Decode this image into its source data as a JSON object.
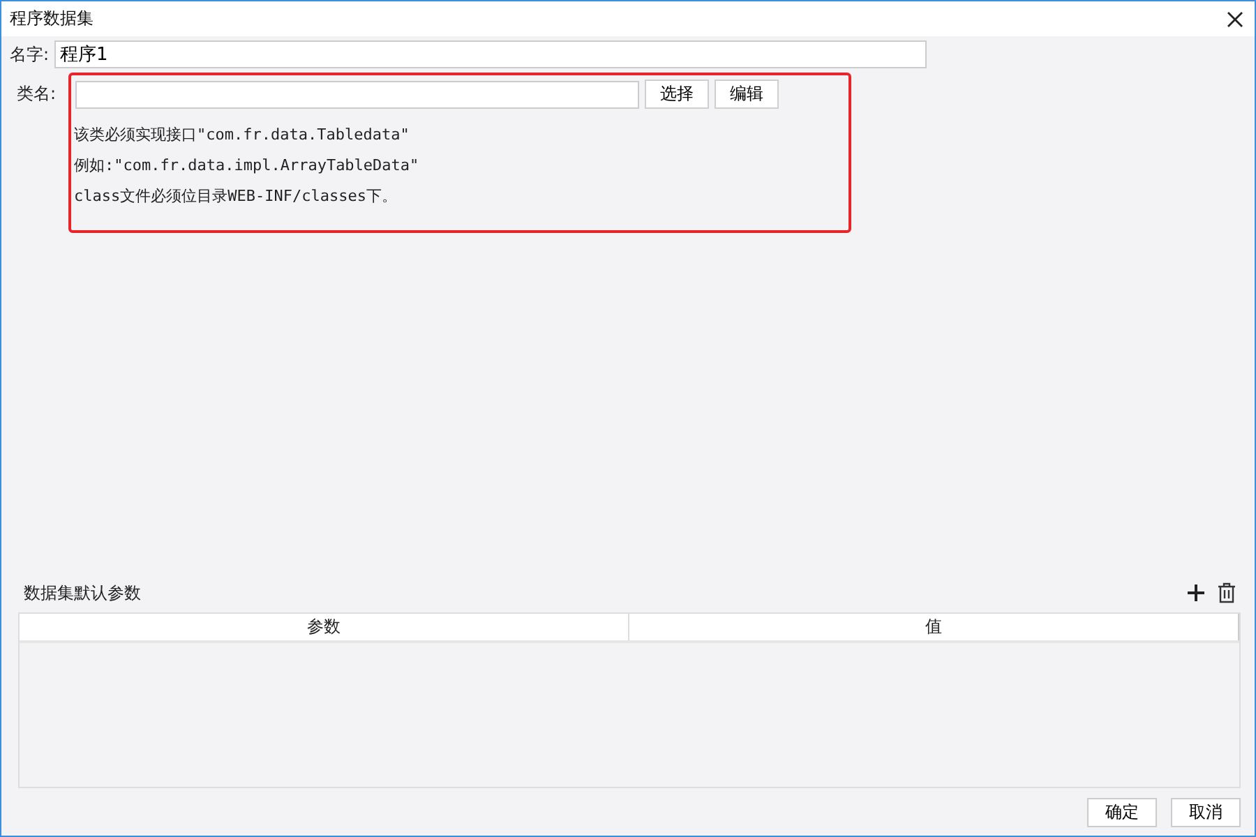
{
  "window": {
    "title": "程序数据集"
  },
  "name_field": {
    "label": "名字:",
    "value": "程序1"
  },
  "class_field": {
    "label": "类名:",
    "buttons": [
      "选择",
      "编辑"
    ]
  },
  "hints": [
    "该类必须实现接口\"com.fr.data.Tabledata\"",
    "例如:\"com.fr.data.impl.ArrayTableData\"",
    "class文件必须位目录WEB-INF/classes下。"
  ],
  "params": {
    "title": "数据集默认参数",
    "columns": [
      "参数",
      "值"
    ]
  },
  "buttons": [
    "确定",
    "取消"
  ]
}
